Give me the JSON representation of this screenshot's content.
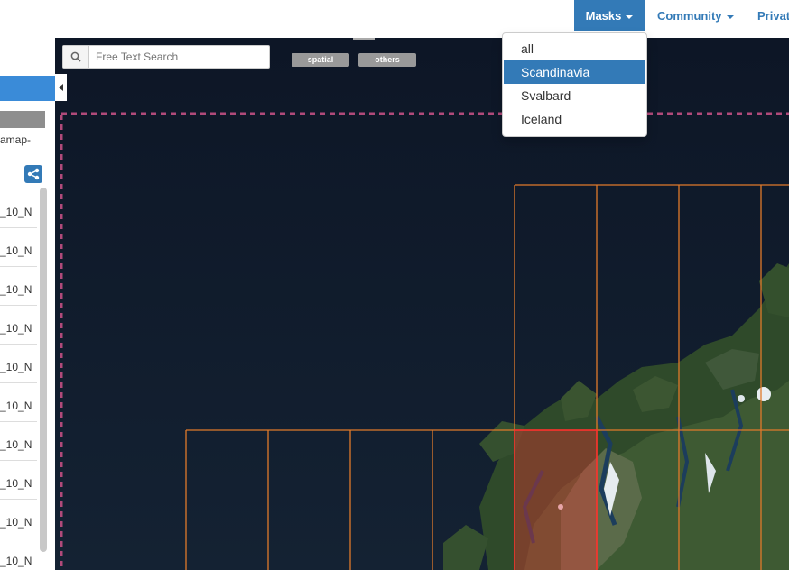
{
  "nav": {
    "masks": "Masks",
    "community": "Community",
    "private": "Privat"
  },
  "masks_menu": {
    "options": [
      "all",
      "Scandinavia",
      "Svalbard",
      "Iceland"
    ],
    "selected": "Scandinavia"
  },
  "search": {
    "placeholder": "Free Text Search"
  },
  "filters": {
    "spatial": "spatial",
    "others": "others"
  },
  "sidebar": {
    "text": "amap-",
    "items": [
      "_10_N",
      "_10_N",
      "_10_N",
      "_10_N",
      "_10_N",
      "_10_N",
      "_10_N",
      "_10_N",
      "_10_N",
      "_10_N"
    ]
  },
  "colors": {
    "accent": "#337ab7",
    "map_background": "#0f1928",
    "tile_grid": "#e07a2b",
    "selected_tile": "#ff2d2d",
    "mask_boundary": "#b04a7a"
  },
  "icons": {
    "search": "search-icon",
    "share": "share-icon",
    "collapse": "chevron-left-icon"
  }
}
